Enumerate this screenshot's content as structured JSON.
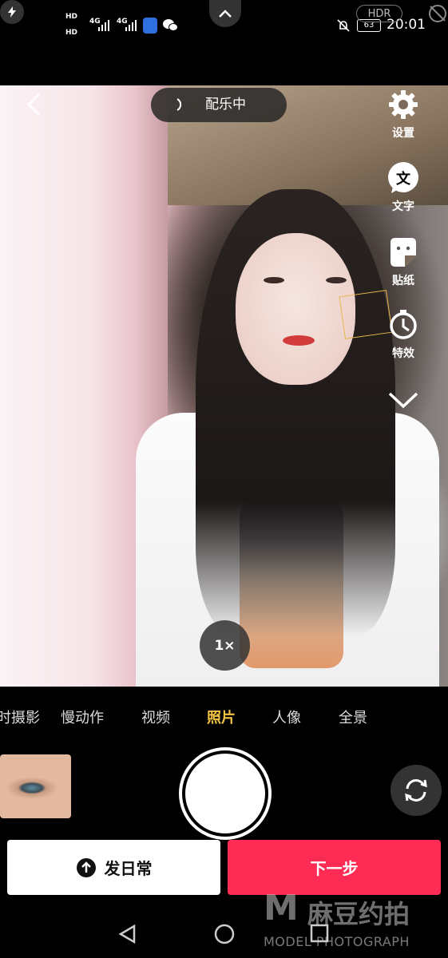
{
  "status_bar": {
    "hd1": "HD",
    "hd2": "HD",
    "sig1": "4G",
    "sig2": "4G",
    "battery": "63",
    "time": "20:01"
  },
  "camera_top": {
    "hdr_label": "HDR",
    "music_label": "配乐中"
  },
  "side_tools": [
    {
      "label": "设置"
    },
    {
      "label": "文字",
      "glyph": "文"
    },
    {
      "label": "贴纸"
    },
    {
      "label": "特效"
    }
  ],
  "zoom": "1×",
  "modes": [
    {
      "label": "时摄影"
    },
    {
      "label": "慢动作"
    },
    {
      "label": "视频"
    },
    {
      "label": "照片",
      "active": true
    },
    {
      "label": "人像"
    },
    {
      "label": "全景"
    }
  ],
  "buttons": {
    "daily": "发日常",
    "next": "下一步"
  },
  "watermark": {
    "letter": "M",
    "cn": "麻豆约拍",
    "en": "MODEL PHOTOGRAPH"
  },
  "colors": {
    "accent": "#fe2c55",
    "active_mode": "#f4c542"
  }
}
